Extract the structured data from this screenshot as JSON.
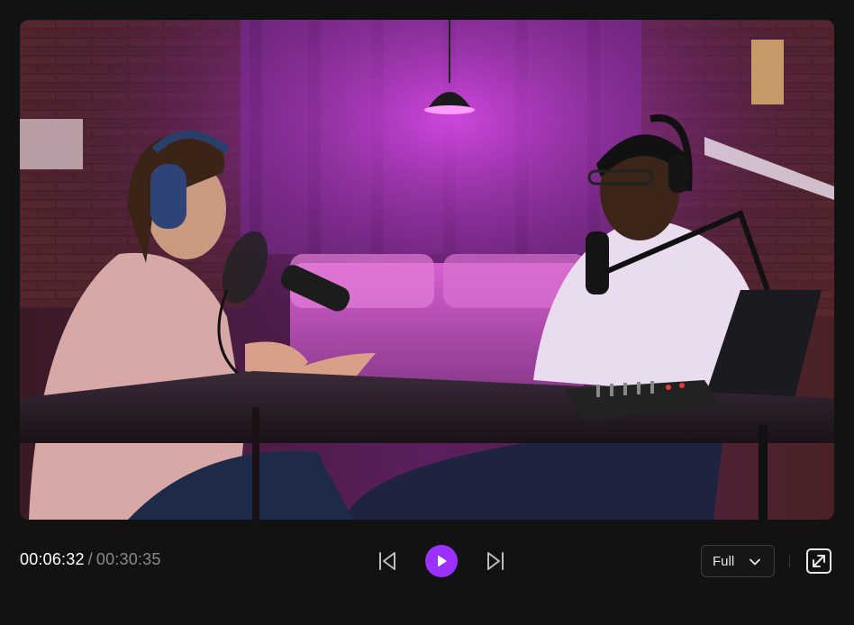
{
  "video": {
    "description_icon": "podcast-studio-scene"
  },
  "playback": {
    "current_time": "00:06:32",
    "separator": "/",
    "total_time": "00:30:35",
    "state": "paused"
  },
  "controls": {
    "previous_icon": "skip-previous-icon",
    "play_icon": "play-icon",
    "next_icon": "skip-next-icon",
    "fullscreen_icon": "fullscreen-icon",
    "accent_color": "#9b30ff"
  },
  "quality": {
    "selected": "Full"
  }
}
